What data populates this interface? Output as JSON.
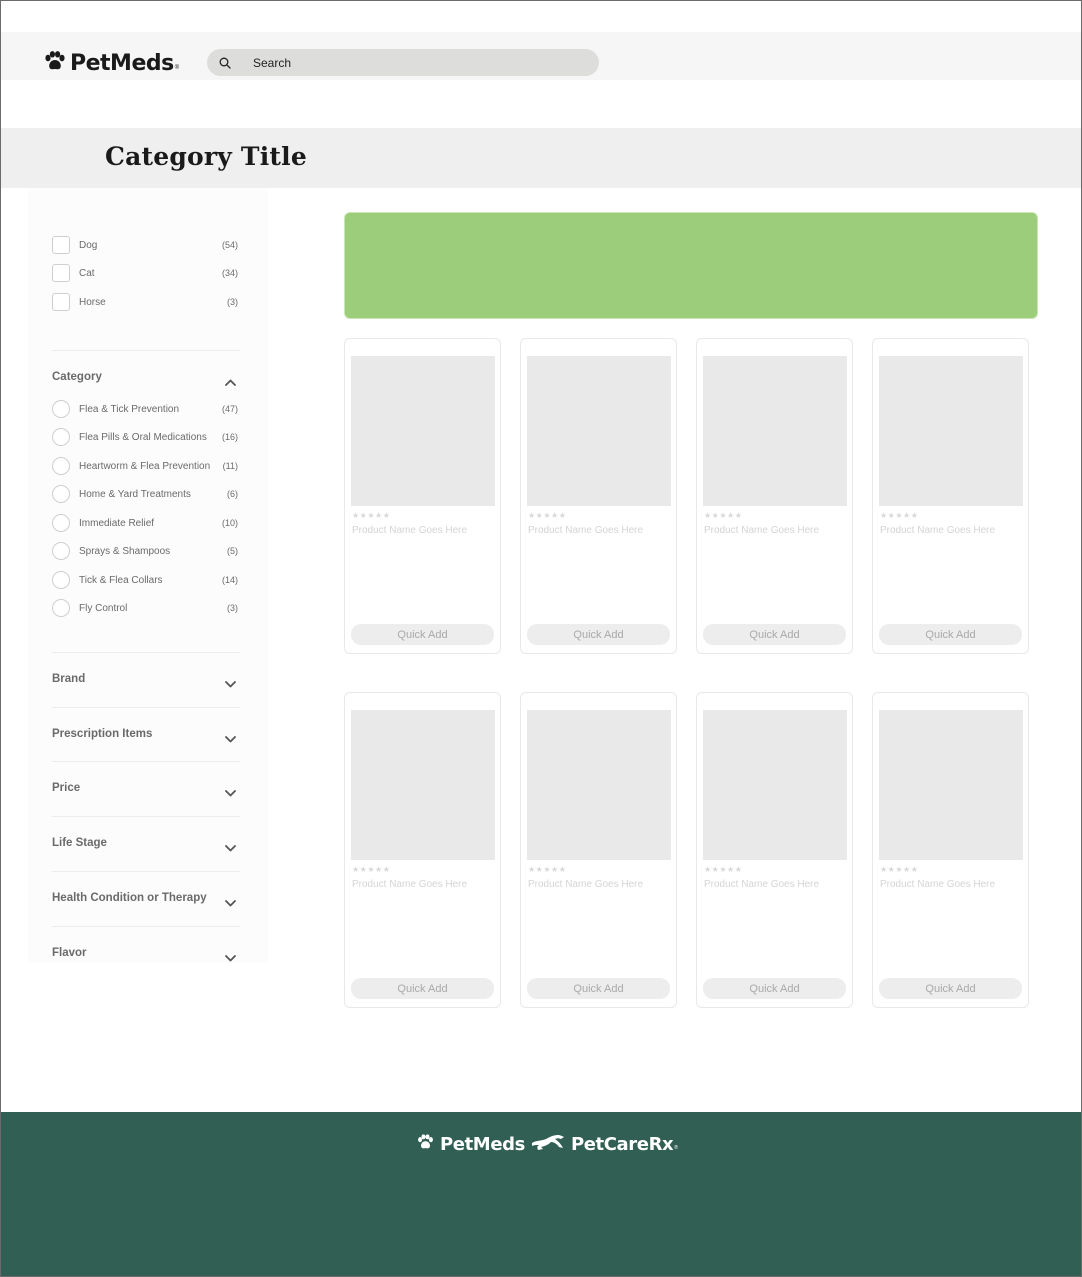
{
  "header": {
    "logo_text": "PetMeds",
    "logo_tm": "®",
    "search_placeholder": "Search"
  },
  "category": {
    "title": "Category Title"
  },
  "sidebar": {
    "pet_filters": [
      {
        "label": "Dog",
        "count": "(54)"
      },
      {
        "label": "Cat",
        "count": "(34)"
      },
      {
        "label": "Horse",
        "count": "(3)"
      }
    ],
    "category_section": {
      "title": "Category",
      "expanded": true,
      "items": [
        {
          "label": "Flea & Tick Prevention",
          "count": "(47)"
        },
        {
          "label": "Flea Pills & Oral Medications",
          "count": "(16)"
        },
        {
          "label": "Heartworm & Flea Prevention",
          "count": "(11)"
        },
        {
          "label": "Home & Yard Treatments",
          "count": "(6)"
        },
        {
          "label": "Immediate Relief",
          "count": "(10)"
        },
        {
          "label": "Sprays & Shampoos",
          "count": "(5)"
        },
        {
          "label": "Tick & Flea Collars",
          "count": "(14)"
        },
        {
          "label": "Fly Control",
          "count": "(3)"
        }
      ]
    },
    "collapsed_sections": [
      {
        "title": "Brand"
      },
      {
        "title": "Prescription Items"
      },
      {
        "title": "Price"
      },
      {
        "title": "Life Stage"
      },
      {
        "title": "Health Condition or Therapy"
      },
      {
        "title": "Flavor"
      }
    ]
  },
  "banner": {
    "color": "#9ccd7b"
  },
  "products": [
    {
      "stars": "★★★★★",
      "name": "Product Name Goes Here",
      "button": "Quick Add"
    },
    {
      "stars": "★★★★★",
      "name": "Product Name Goes Here",
      "button": "Quick Add"
    },
    {
      "stars": "★★★★★",
      "name": "Product Name Goes Here",
      "button": "Quick Add"
    },
    {
      "stars": "★★★★★",
      "name": "Product Name Goes Here",
      "button": "Quick Add"
    },
    {
      "stars": "★★★★★",
      "name": "Product Name Goes Here",
      "button": "Quick Add"
    },
    {
      "stars": "★★★★★",
      "name": "Product Name Goes Here",
      "button": "Quick Add"
    },
    {
      "stars": "★★★★★",
      "name": "Product Name Goes Here",
      "button": "Quick Add"
    },
    {
      "stars": "★★★★★",
      "name": "Product Name Goes Here",
      "button": "Quick Add"
    }
  ],
  "footer": {
    "brand_1": "PetMeds",
    "brand_2": "PetCareRx",
    "brand_tm": "®",
    "color": "#325f53"
  },
  "icons": {
    "logo": "paw-icon",
    "search": "search-icon",
    "expand": "chevron-up-icon",
    "collapse": "chevron-down-icon",
    "footer_runner": "running-dog-icon"
  }
}
